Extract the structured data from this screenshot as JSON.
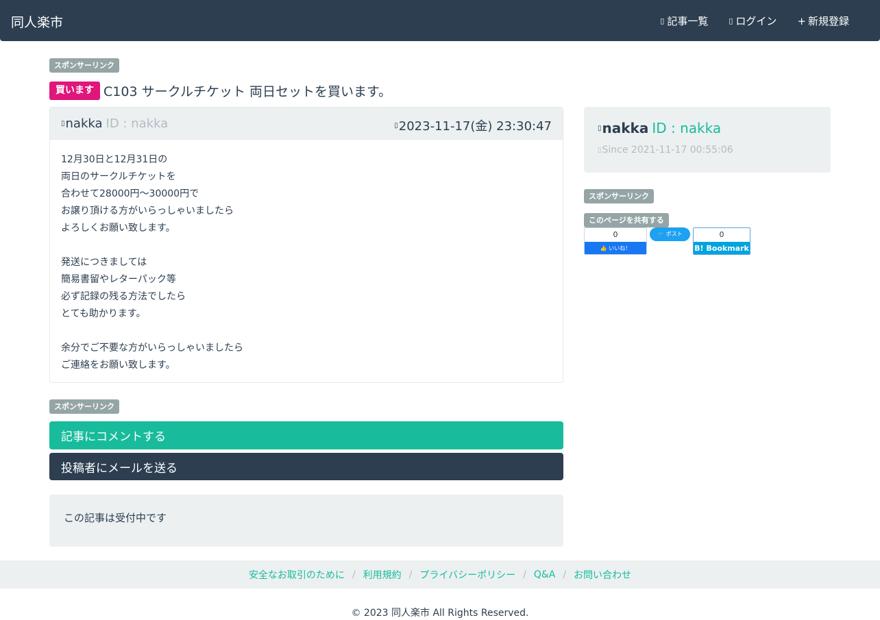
{
  "header": {
    "brand": "同人楽市",
    "nav": [
      {
        "label": "記事一覧"
      },
      {
        "label": "ログイン"
      },
      {
        "label": "新規登録"
      }
    ]
  },
  "sponsor_label": "スポンサーリンク",
  "article": {
    "type_badge": "買います",
    "title": "C103 サークルチケット 両日セットを買います。",
    "poster_name": "nakka",
    "poster_id": "ID : nakka",
    "posted_at": "2023-11-17(金) 23:30:47",
    "body_lines": [
      "12月30日と12月31日の",
      "両日のサークルチケットを",
      "合わせて28000円〜30000円で",
      "お譲り頂ける方がいらっしゃいましたら",
      "よろしくお願い致します。",
      "",
      "発送につきましては",
      "簡易書留やレターパック等",
      "必ず記録の残る方法でしたら",
      "とても助かります。",
      "",
      "余分でご不要な方がいらっしゃいましたら",
      "ご連絡をお願い致します。"
    ]
  },
  "actions": {
    "comment_label": "記事にコメントする",
    "mail_label": "投稿者にメールを送る"
  },
  "status_text": "この記事は受付中です",
  "profile": {
    "name": "nakka",
    "id": "ID : nakka",
    "since": "Since 2021-11-17 00:55:06"
  },
  "share": {
    "label": "このページを共有する",
    "fb_count": "0",
    "fb_label": "いいね！",
    "tw_label": "ポスト",
    "hb_count": "0",
    "hb_label": "B! Bookmark"
  },
  "footer": {
    "links": [
      "安全なお取引のために",
      "利用規約",
      "プライバシーポリシー",
      "Q&A",
      "お問い合わせ"
    ],
    "copyright": "© 2023 同人楽市 All Rights Reserved."
  }
}
